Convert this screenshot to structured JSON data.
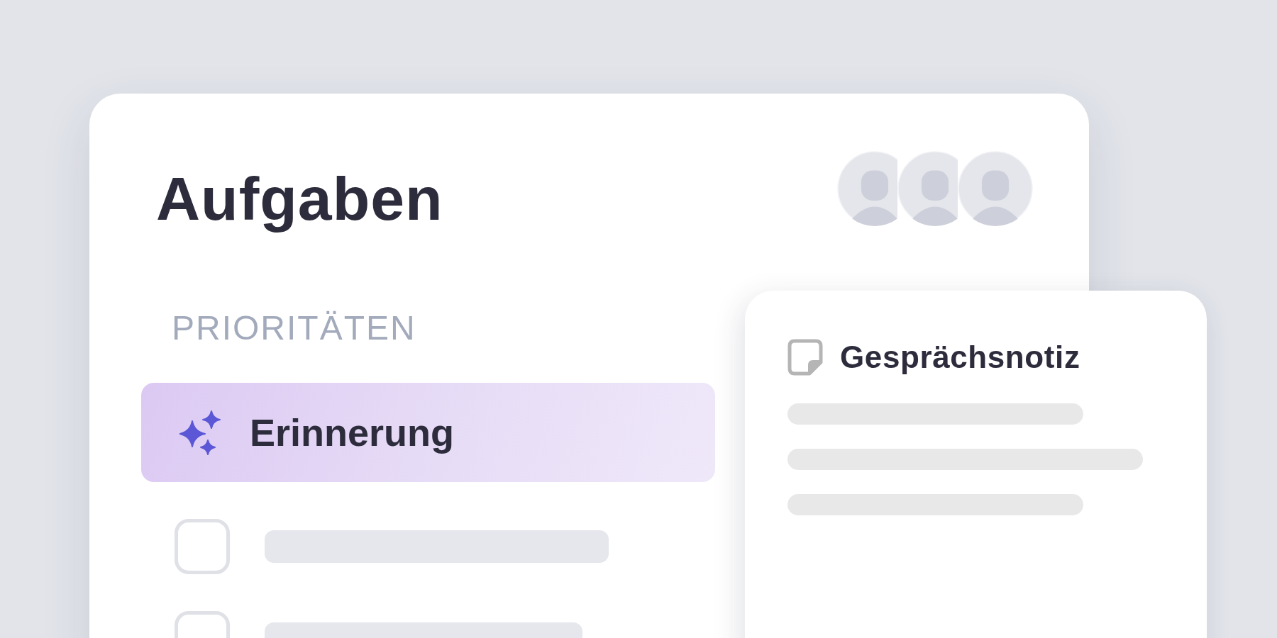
{
  "header": {
    "title": "Aufgaben"
  },
  "section": {
    "label": "PRIORITÄTEN"
  },
  "items": [
    {
      "kind": "reminder",
      "label": "Erinnerung"
    },
    {
      "kind": "task",
      "checked": false
    },
    {
      "kind": "task",
      "checked": false
    }
  ],
  "note": {
    "title": "Gesprächsnotiz"
  }
}
